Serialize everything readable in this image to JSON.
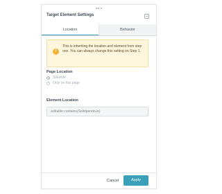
{
  "panel": {
    "title": "Target Element Settings"
  },
  "tabs": [
    {
      "label": "Location",
      "active": true
    },
    {
      "label": "Behavior",
      "active": false
    }
  ],
  "notice": {
    "icon": "exclamation-icon",
    "text": "This is inheriting the location and element from step one. You can always change this setting on Step 1."
  },
  "page_location": {
    "label": "Page Location",
    "options": [
      {
        "label": "Sitewide",
        "selected": true
      },
      {
        "label": "Only on this page",
        "selected": false
      }
    ]
  },
  "element_location": {
    "label": "Element Location",
    "value": ".editable:contains(Solidpendo.io)"
  },
  "footer": {
    "cancel_label": "Cancel",
    "apply_label": "Apply"
  },
  "colors": {
    "accent": "#3aa0b8",
    "notice_bg": "#fff7dd",
    "warning": "#f2b236"
  }
}
